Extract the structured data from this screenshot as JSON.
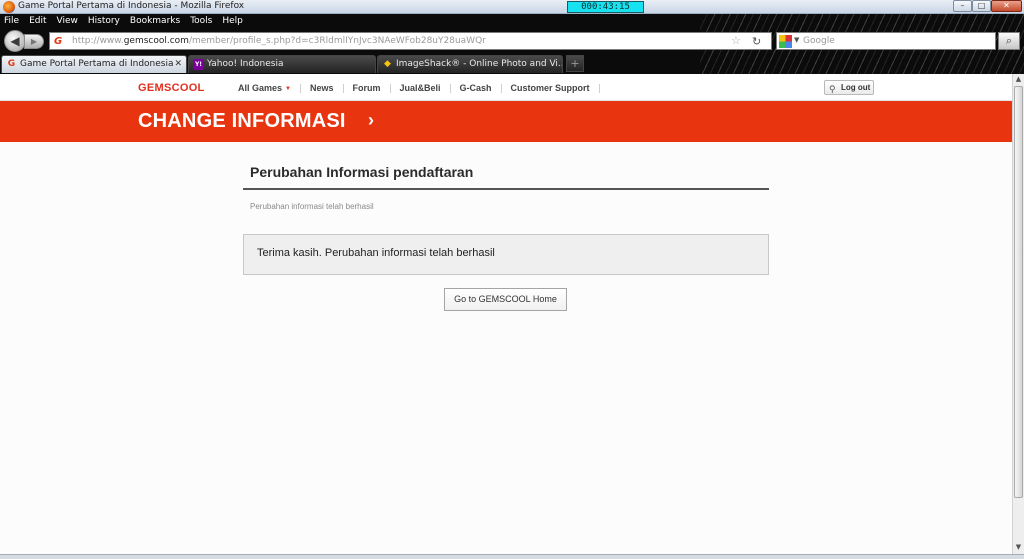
{
  "window": {
    "title": "Game Portal Pertama di Indonesia - Mozilla Firefox",
    "timer": "000:43:15",
    "minimize_glyph": "–",
    "maximize_glyph": "□",
    "close_glyph": "✕"
  },
  "menu": [
    "File",
    "Edit",
    "View",
    "History",
    "Bookmarks",
    "Tools",
    "Help"
  ],
  "navbar": {
    "back_glyph": "◀",
    "forward_glyph": "▶",
    "url_prefix": "http://www.",
    "url_domain": "gemscool.com",
    "url_path": "/member/profile_s.php?d=c3RldmlIYnJvc3NAeWFob28uY28uaWQr",
    "bookmark_glyph": "☆",
    "reload_glyph": "↻",
    "search_placeholder": "Google",
    "search_go_glyph": "⌕"
  },
  "tabs": [
    {
      "label": "Game Portal Pertama di Indonesia",
      "favicon": "gemscool-icon",
      "fav_glyph": "G",
      "active": true,
      "close_glyph": "✕"
    },
    {
      "label": "Yahoo! Indonesia",
      "favicon": "yahoo-icon",
      "fav_glyph": "Y!",
      "active": false
    },
    {
      "label": "ImageShack® - Online Photo and Vi...",
      "favicon": "imageshack-icon",
      "fav_glyph": "◆",
      "active": false
    }
  ],
  "new_tab_glyph": "+",
  "site": {
    "logo": "GEMSCOOL",
    "menu": [
      {
        "label": "All Games",
        "dropdown": true
      },
      {
        "label": "News"
      },
      {
        "label": "Forum"
      },
      {
        "label": "Jual&Beli"
      },
      {
        "label": "G-Cash"
      },
      {
        "label": "Customer Support"
      }
    ],
    "logout": "Log out",
    "logout_icon_glyph": "⚲"
  },
  "banner": {
    "title": "CHANGE INFORMASI",
    "chevron": "›"
  },
  "section": {
    "title": "Perubahan Informasi pendaftaran",
    "subtitle": "Perubahan informasi telah berhasil",
    "message": "Terima kasih. Perubahan informasi telah berhasil",
    "home_button": "Go to GEMSCOOL Home"
  },
  "colors": {
    "brand_red": "#e8340f",
    "timer_bg": "#17e3f0"
  }
}
